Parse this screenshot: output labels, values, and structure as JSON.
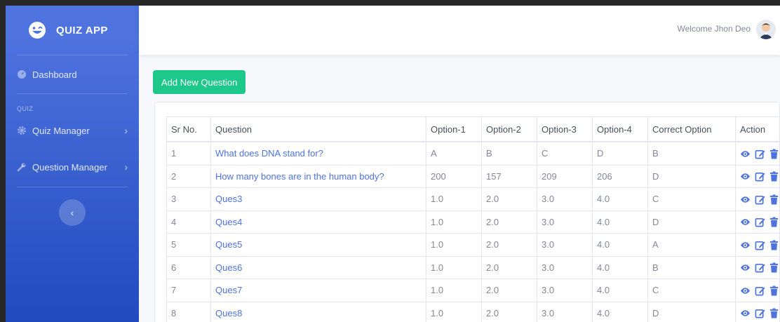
{
  "app": {
    "name": "QUIZ APP"
  },
  "sidebar": {
    "dashboard_label": "Dashboard",
    "section_heading": "QUIZ",
    "items": [
      {
        "label": "Quiz Manager",
        "icon": "gear-icon"
      },
      {
        "label": "Question Manager",
        "icon": "wrench-icon"
      }
    ]
  },
  "topbar": {
    "welcome": "Welcome Jhon Deo"
  },
  "actions": {
    "add_question": "Add New Question"
  },
  "table": {
    "headers": [
      "Sr No.",
      "Question",
      "Option-1",
      "Option-2",
      "Option-3",
      "Option-4",
      "Correct Option",
      "Action"
    ],
    "rows": [
      [
        "1",
        "What does DNA stand for?",
        "A",
        "B",
        "C",
        "D",
        "B"
      ],
      [
        "2",
        "How many bones are in the human body?",
        "200",
        "157",
        "209",
        "206",
        "D"
      ],
      [
        "3",
        "Ques3",
        "1.0",
        "2.0",
        "3.0",
        "4.0",
        "C"
      ],
      [
        "4",
        "Ques4",
        "1.0",
        "2.0",
        "3.0",
        "4.0",
        "D"
      ],
      [
        "5",
        "Ques5",
        "1.0",
        "2.0",
        "3.0",
        "4.0",
        "A"
      ],
      [
        "6",
        "Ques6",
        "1.0",
        "2.0",
        "3.0",
        "4.0",
        "B"
      ],
      [
        "7",
        "Ques7",
        "1.0",
        "2.0",
        "3.0",
        "4.0",
        "C"
      ],
      [
        "8",
        "Ques8",
        "1.0",
        "2.0",
        "3.0",
        "4.0",
        "D"
      ]
    ]
  },
  "colors": {
    "primary": "#4e73df",
    "success": "#1cc88a",
    "muted": "#858796"
  }
}
